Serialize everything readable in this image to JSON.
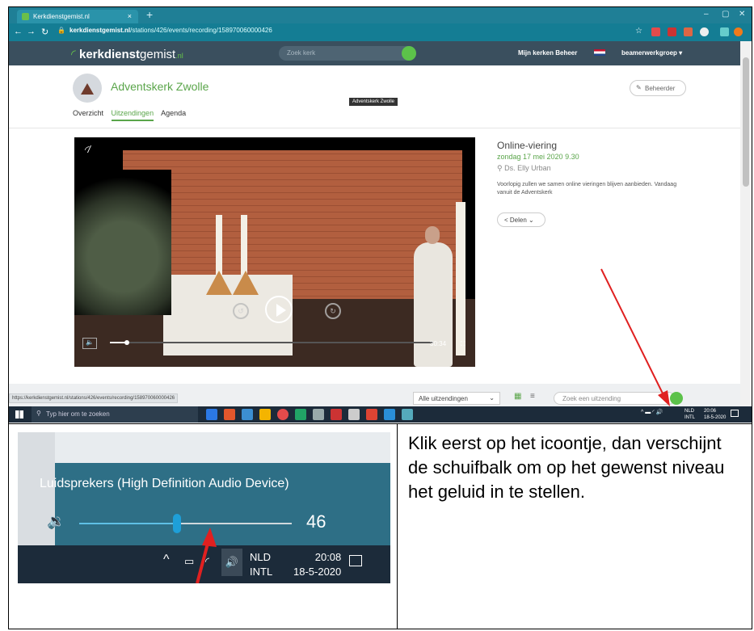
{
  "browser": {
    "tab_title": "Kerkdienstgemist.nl",
    "tab_close": "×",
    "new_tab": "+",
    "window_controls": [
      "–",
      "▢",
      "✕"
    ],
    "url_domain": "kerkdienstgemist.nl",
    "url_path": "/stations/426/events/recording/158970060000426",
    "status_url": "https://kerkdienstgemist.nl/stations/426/events/recording/158970060000426"
  },
  "site": {
    "logo_bold": "kerkdienst",
    "logo_rest": "gemist",
    "logo_tld": ".nl",
    "search_placeholder": "Zoek kerk",
    "nav": "Mijn kerken  Beheer",
    "user": "beamerwerkgroep ▾",
    "church_name": "Adventskerk Zwolle",
    "tooltip": "Adventskerk Zwolle",
    "beheerder": "Beheerder",
    "tabs": [
      "Overzicht",
      "Uitzendingen",
      "Agenda"
    ],
    "active_tab": "Uitzendingen"
  },
  "video": {
    "time": "30:34",
    "colors": {
      "accent": "#5aa54a",
      "header": "#3a4f5e"
    }
  },
  "event": {
    "title": "Online-viering",
    "date": "zondag 17 mei 2020 9.30",
    "preacher": "Ds. Elly Urban",
    "description": "Voorlopig zullen we samen online vieringen blijven aanbieden. Vandaag vanuit de Adventskerk",
    "share": "Delen"
  },
  "footer": {
    "filter": "Alle uitzendingen",
    "search_placeholder": "Zoek een uitzending"
  },
  "taskbar": {
    "search": "Typ hier om te zoeken",
    "lang1": "NLD",
    "lang2": "INTL",
    "time": "20:06",
    "date": "18-5-2020"
  },
  "zoom": {
    "device": "Luidsprekers (High Definition Audio Device)",
    "volume": "46",
    "volume_fraction": 0.46,
    "lang1": "NLD",
    "lang2": "INTL",
    "time": "20:08",
    "date": "18-5-2020"
  },
  "instruction": "Klik eerst op het icoontje, dan verschijnt de schuifbalk om op het gewenst niveau het geluid in te stellen."
}
